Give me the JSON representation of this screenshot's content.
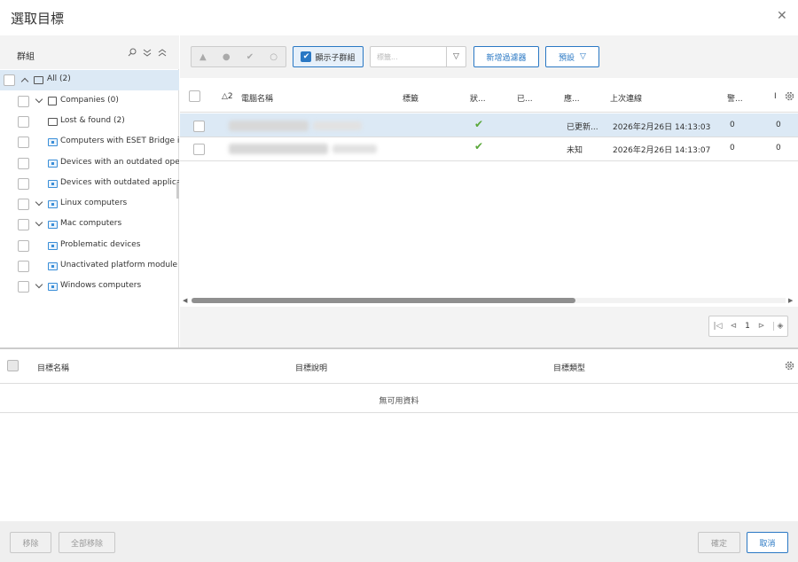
{
  "dialog": {
    "title": "選取目標",
    "close_icon": "close-icon"
  },
  "groups_panel": {
    "title": "群組",
    "items": [
      {
        "label": "All (2)",
        "expanded": true,
        "selected": true
      },
      {
        "label": "Companies (0)"
      },
      {
        "label": "Lost & found (2)"
      },
      {
        "label": "Computers with ESET Bridge inst"
      },
      {
        "label": "Devices with an outdated operat"
      },
      {
        "label": "Devices with outdated applicatic"
      },
      {
        "label": "Linux computers"
      },
      {
        "label": "Mac computers"
      },
      {
        "label": "Problematic devices"
      },
      {
        "label": "Unactivated platform module"
      },
      {
        "label": "Windows computers"
      }
    ]
  },
  "toolbar": {
    "show_subgroups_label": "顯示子群組",
    "tags_placeholder": "標籤...",
    "add_filter_label": "新增過濾器",
    "preset_label": "預設"
  },
  "computers_table": {
    "sort_indicator": "2",
    "columns": [
      "電腦名稱",
      "標籤",
      "狀...",
      "已...",
      "應...",
      "上次連線",
      "警...",
      "I"
    ],
    "rows": [
      {
        "status": "✔",
        "module": "已更新...",
        "last_connected": "2026年2月26日 14:13:03",
        "alerts": "0",
        "threats": "0"
      },
      {
        "status": "✔",
        "module": "未知",
        "last_connected": "2026年2月26日 14:13:07",
        "alerts": "0",
        "threats": "0"
      }
    ],
    "page": "1"
  },
  "targets_table": {
    "columns": [
      "目標名稱",
      "目標說明",
      "目標類型"
    ],
    "empty_text": "無可用資料"
  },
  "footer": {
    "remove_label": "移除",
    "remove_all_label": "全部移除",
    "ok_label": "確定",
    "cancel_label": "取消"
  },
  "colors": {
    "accent": "#2a78c4",
    "selected_row": "#dce9f5",
    "status_ok": "#5aa83a"
  }
}
